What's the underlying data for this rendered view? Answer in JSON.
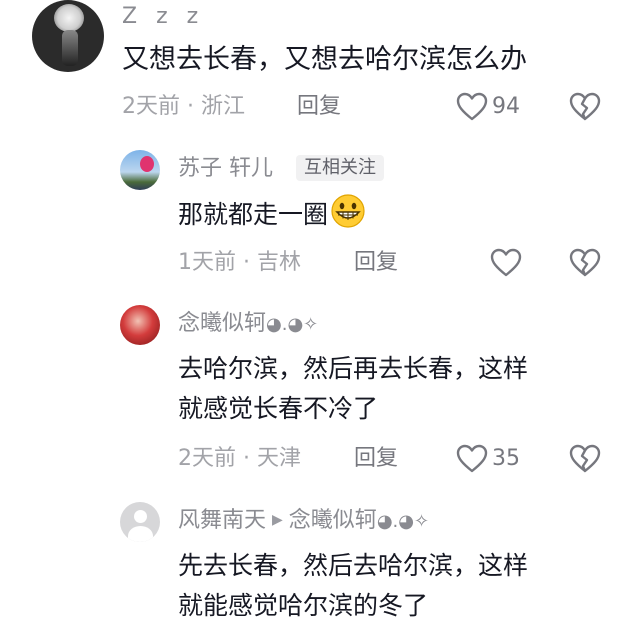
{
  "comments": [
    {
      "username": "Z z z",
      "text": "又想去长春，又想去哈尔滨怎么办",
      "time_location": "2天前 · 浙江",
      "reply_label": "回复",
      "likes": "94"
    }
  ],
  "replies": [
    {
      "username": "苏子 轩儿",
      "tag": "互相关注",
      "text_line1": "那就都走一圈",
      "emoji": "grinning-face-icon",
      "time_location": "1天前 · 吉林",
      "reply_label": "回复"
    },
    {
      "username": "念曦似轲",
      "username_deco": "◕.◕✧",
      "text_line1": "去哈尔滨，然后再去长春，这样",
      "text_line2": "就感觉长春不冷了",
      "time_location": "2天前 · 天津",
      "reply_label": "回复",
      "likes": "35"
    },
    {
      "username": "风舞南天",
      "reply_to": "念曦似轲",
      "reply_to_deco": "◕.◕✧",
      "text_line1": "先去长春，然后去哈尔滨，这样",
      "text_line2": "就能感觉哈尔滨的冬了"
    }
  ],
  "colors": {
    "text": "#161823",
    "name": "#8a8b91",
    "meta": "#a2a3a8",
    "icon": "#76777e"
  }
}
